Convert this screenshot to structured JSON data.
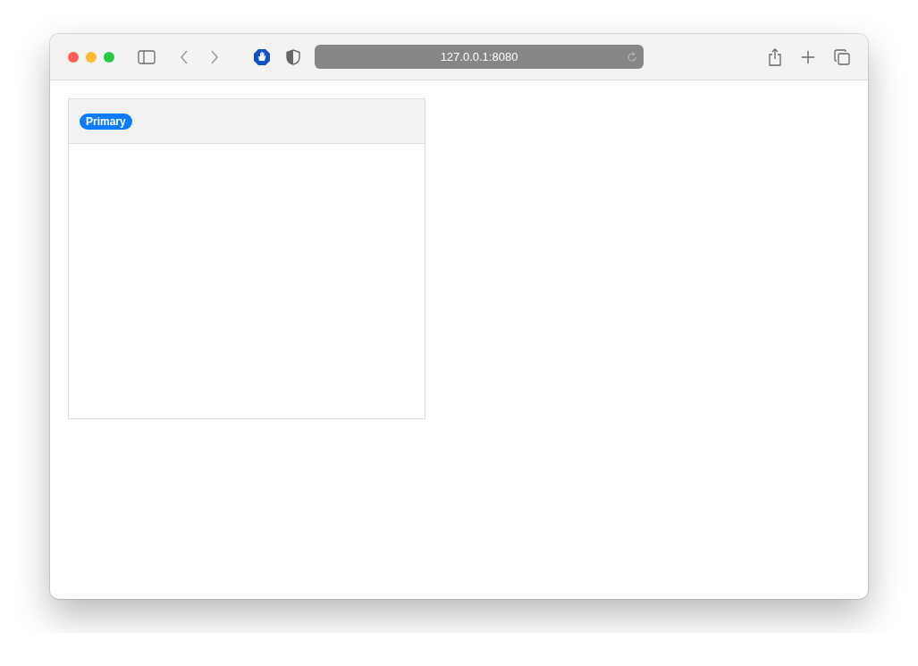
{
  "browser": {
    "url": "127.0.0.1:8080"
  },
  "card": {
    "badge": "Primary"
  }
}
